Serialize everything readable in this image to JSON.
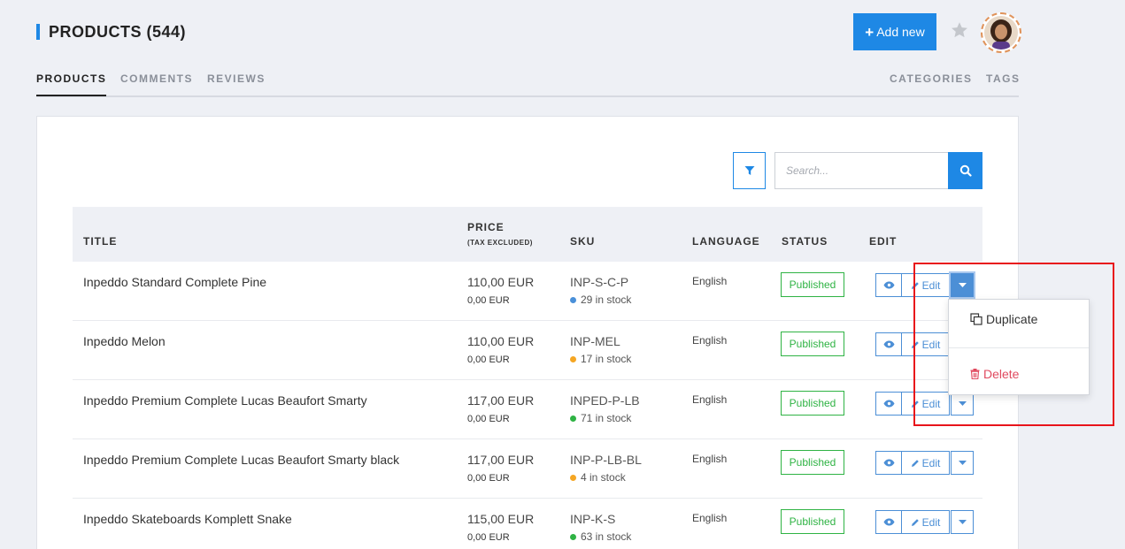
{
  "header": {
    "title": "PRODUCTS (544)",
    "add_button": "Add new",
    "add_icon": "+"
  },
  "tabs": {
    "left": [
      {
        "label": "PRODUCTS",
        "active": true
      },
      {
        "label": "COMMENTS",
        "active": false
      },
      {
        "label": "REVIEWS",
        "active": false
      }
    ],
    "right": [
      {
        "label": "CATEGORIES"
      },
      {
        "label": "TAGS"
      }
    ]
  },
  "search": {
    "placeholder": "Search..."
  },
  "table": {
    "headers": {
      "title": "TITLE",
      "price": "PRICE",
      "price_sub": "(TAX EXCLUDED)",
      "sku": "SKU",
      "language": "LANGUAGE",
      "status": "STATUS",
      "edit": "EDIT"
    },
    "edit_label": "Edit",
    "rows": [
      {
        "title": "Inpeddo Standard Complete Pine",
        "price": "110,00 EUR",
        "price_tax": "0,00 EUR",
        "sku": "INP-S-C-P",
        "stock": "29 in stock",
        "stock_color": "#4a90d9",
        "language": "English",
        "status": "Published"
      },
      {
        "title": "Inpeddo Melon",
        "price": "110,00 EUR",
        "price_tax": "0,00 EUR",
        "sku": "INP-MEL",
        "stock": "17 in stock",
        "stock_color": "#f5a623",
        "language": "English",
        "status": "Published"
      },
      {
        "title": "Inpeddo Premium Complete Lucas Beaufort Smarty",
        "price": "117,00 EUR",
        "price_tax": "0,00 EUR",
        "sku": "INPED-P-LB",
        "stock": "71 in stock",
        "stock_color": "#2fb344",
        "language": "English",
        "status": "Published"
      },
      {
        "title": "Inpeddo Premium Complete Lucas Beaufort Smarty black",
        "price": "117,00 EUR",
        "price_tax": "0,00 EUR",
        "sku": "INP-P-LB-BL",
        "stock": "4 in stock",
        "stock_color": "#f5a623",
        "language": "English",
        "status": "Published"
      },
      {
        "title": "Inpeddo Skateboards Komplett Snake",
        "price": "115,00 EUR",
        "price_tax": "0,00 EUR",
        "sku": "INP-K-S",
        "stock": "63 in stock",
        "stock_color": "#2fb344",
        "language": "English",
        "status": "Published"
      }
    ]
  },
  "dropdown": {
    "duplicate": "Duplicate",
    "delete": "Delete"
  },
  "colors": {
    "accent": "#1e88e5",
    "published": "#2fb344",
    "delete": "#e04a5f",
    "highlight": "#e8141b"
  }
}
